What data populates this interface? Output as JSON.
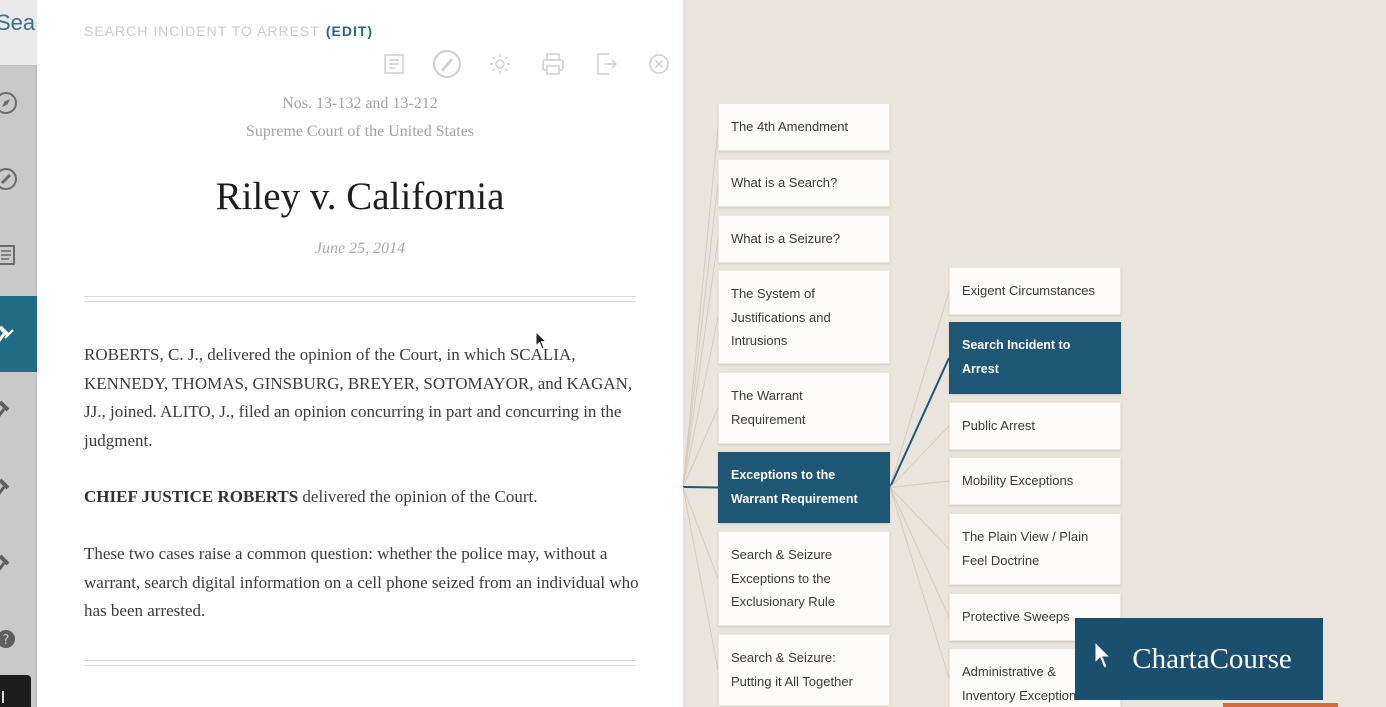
{
  "rail": {
    "search_text": "Sea",
    "items": [
      {
        "name": "compass-icon"
      },
      {
        "name": "pen-icon"
      },
      {
        "name": "document-icon"
      },
      {
        "name": "gavel-icon"
      },
      {
        "name": "gavel-icon"
      },
      {
        "name": "gavel-icon"
      },
      {
        "name": "gavel-icon"
      },
      {
        "name": "help-icon"
      }
    ]
  },
  "doc": {
    "breadcrumb": "SEARCH INCIDENT TO ARREST",
    "edit_label": "(EDIT)",
    "toolbar": [
      "notes-icon",
      "compass-icon",
      "brightness-icon",
      "print-icon",
      "export-icon",
      "close-icon"
    ],
    "docket": "Nos. 13-132 and 13-212",
    "court": "Supreme Court of the United States",
    "title": "Riley v. California",
    "date": "June 25, 2014",
    "para1": "ROBERTS, C. J., delivered the opinion of the Court, in which SCALIA, KENNEDY, THOMAS, GINSBURG, BREYER, SOTOMAYOR, and KAGAN, JJ., joined. ALITO, J., filed an opinion concurring in part and concurring in the judgment.",
    "para2_bold": "CHIEF JUSTICE ROBERTS",
    "para2_rest": " delivered the opinion of the Court.",
    "para3": "These two cases raise a common question: whether the police may, without a warrant, search digital information on a cell phone seized from an individual who has been arrested."
  },
  "map": {
    "column1": [
      {
        "lines": [
          "The 4th Amendment"
        ]
      },
      {
        "lines": [
          "What is a Search?"
        ]
      },
      {
        "lines": [
          "What is a Seizure?"
        ]
      },
      {
        "lines": [
          "The System of",
          "Justifications and",
          "Intrusions"
        ]
      },
      {
        "lines": [
          "The Warrant",
          "Requirement"
        ]
      },
      {
        "lines": [
          "Exceptions to the",
          "Warrant Requirement"
        ],
        "active": true
      },
      {
        "lines": [
          "Search & Seizure",
          "Exceptions to the",
          "Exclusionary Rule"
        ]
      },
      {
        "lines": [
          "Search & Seizure:",
          "Putting it All Together"
        ]
      }
    ],
    "column2": [
      {
        "lines": [
          "Exigent Circumstances"
        ]
      },
      {
        "lines": [
          "Search Incident to",
          "Arrest"
        ],
        "active": true
      },
      {
        "lines": [
          "Public Arrest"
        ]
      },
      {
        "lines": [
          "Mobility Exceptions"
        ]
      },
      {
        "lines": [
          "The Plain View / Plain",
          "Feel Doctrine"
        ]
      },
      {
        "lines": [
          "Protective Sweeps"
        ]
      },
      {
        "lines": [
          "Administrative &",
          "Inventory Exceptions"
        ]
      }
    ],
    "line_color": "#7e97a6",
    "active_color": "#1d5775"
  },
  "brand": {
    "name": "ChartaCourse",
    "color": "#1a4f6e"
  }
}
